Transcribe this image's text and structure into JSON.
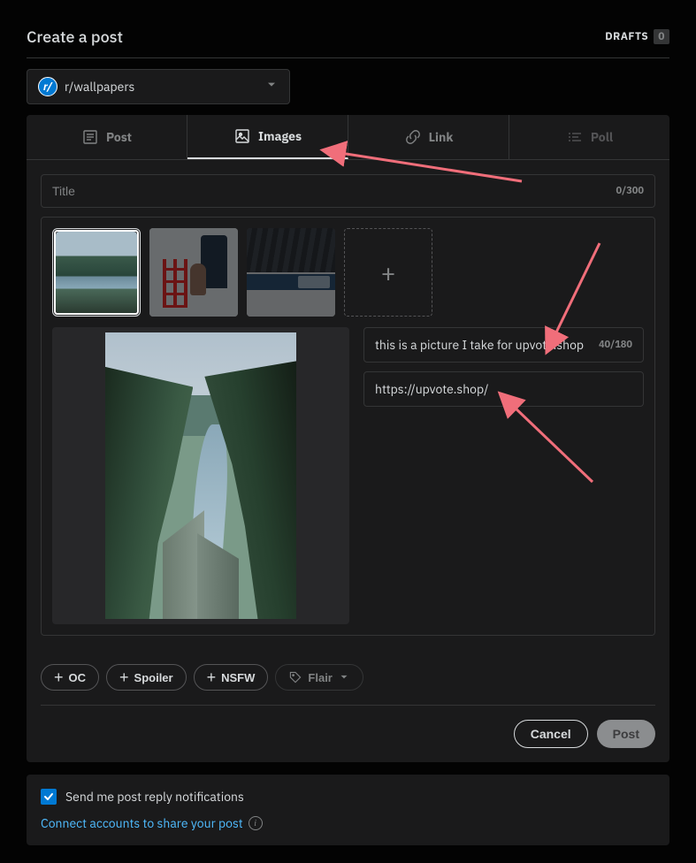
{
  "header": {
    "title": "Create a post",
    "drafts_label": "DRAFTS",
    "drafts_count": "0"
  },
  "community": {
    "name": "r/wallpapers"
  },
  "tabs": {
    "post": "Post",
    "images": "Images",
    "link": "Link",
    "poll": "Poll"
  },
  "title_field": {
    "placeholder": "Title",
    "counter": "0/300"
  },
  "image_meta": {
    "caption": "this is a picture I take for upvote.shop",
    "caption_counter": "40/180",
    "link": "https://upvote.shop/"
  },
  "tags": {
    "oc": "OC",
    "spoiler": "Spoiler",
    "nsfw": "NSFW",
    "flair": "Flair"
  },
  "actions": {
    "cancel": "Cancel",
    "post": "Post"
  },
  "footer": {
    "notify_label": "Send me post reply notifications",
    "connect_label": "Connect accounts to share your post"
  },
  "arrow_color": "#f06e7a"
}
